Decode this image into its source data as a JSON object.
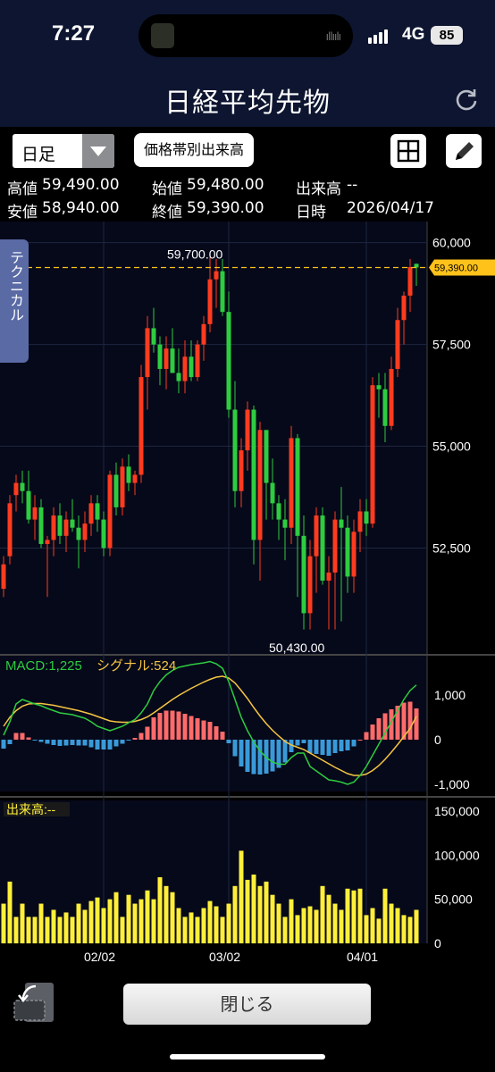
{
  "status": {
    "time": "7:27",
    "network": "4G",
    "battery": "85"
  },
  "header": {
    "title": "日経平均先物"
  },
  "toolbar": {
    "period": "日足",
    "price_band_button": "価格帯別出来高"
  },
  "info": {
    "high_label": "高値",
    "high": "59,490.00",
    "open_label": "始値",
    "open": "59,480.00",
    "volume_label": "出来高",
    "volume": "--",
    "low_label": "安値",
    "low": "58,940.00",
    "close_label": "終値",
    "close": "59,390.00",
    "datetime_label": "日時",
    "date": "2026/04/17"
  },
  "side_tab": "テクニカル",
  "close_button": "閉じる",
  "colors": {
    "up": "#ff3b1f",
    "down": "#2ecc40",
    "macd": "#2ecc40",
    "signal": "#f5c542",
    "hist_pos": "#ff6b6b",
    "hist_neg": "#3a9ad9",
    "volume": "#ffef3a",
    "price_line": "#ffc21a",
    "header_bg": "#0d1530"
  },
  "chart_data": {
    "type": "candlestick",
    "price_axis": {
      "ticks": [
        60000,
        57500,
        55000,
        52500
      ],
      "tick_labels": [
        "60,000",
        "57,500",
        "55,000",
        "52,500"
      ],
      "range": [
        49900,
        60300
      ]
    },
    "annotations": {
      "high_label": "59,700.00",
      "high_value": 59700,
      "low_label": "50,430.00",
      "low_value": 50430,
      "current_label": "59,390.00",
      "current_value": 59390
    },
    "x_labels": [
      {
        "label": "02/02",
        "index": 16
      },
      {
        "label": "03/02",
        "index": 36
      },
      {
        "label": "04/01",
        "index": 58
      }
    ],
    "candles": [
      [
        51500,
        52300,
        51300,
        52100
      ],
      [
        52300,
        53800,
        52100,
        53600
      ],
      [
        53800,
        54300,
        53400,
        54100
      ],
      [
        54100,
        54400,
        53600,
        53900
      ],
      [
        53900,
        54400,
        53100,
        53200
      ],
      [
        53200,
        53800,
        52700,
        53500
      ],
      [
        53500,
        53700,
        52500,
        52600
      ],
      [
        52600,
        52800,
        51300,
        52700
      ],
      [
        52700,
        53500,
        52300,
        53300
      ],
      [
        53300,
        53600,
        52600,
        52800
      ],
      [
        52800,
        53400,
        52400,
        53200
      ],
      [
        53200,
        53700,
        52900,
        53000
      ],
      [
        53000,
        53300,
        52000,
        52700
      ],
      [
        52700,
        53400,
        52400,
        53100
      ],
      [
        53100,
        53800,
        52800,
        53600
      ],
      [
        53600,
        53800,
        52900,
        53200
      ],
      [
        53200,
        53400,
        52300,
        52500
      ],
      [
        52500,
        54400,
        52300,
        54300
      ],
      [
        54300,
        54600,
        53300,
        53500
      ],
      [
        53500,
        54700,
        53300,
        54500
      ],
      [
        54500,
        54800,
        53900,
        54100
      ],
      [
        54100,
        54400,
        53800,
        54300
      ],
      [
        54300,
        57000,
        54100,
        56700
      ],
      [
        56700,
        58200,
        55900,
        57900
      ],
      [
        57900,
        58400,
        57300,
        57500
      ],
      [
        57500,
        57700,
        56500,
        56900
      ],
      [
        56900,
        57700,
        56400,
        57400
      ],
      [
        57400,
        57900,
        56800,
        56800
      ],
      [
        56800,
        57400,
        56300,
        56600
      ],
      [
        56600,
        57600,
        56300,
        57200
      ],
      [
        57200,
        57600,
        56600,
        56700
      ],
      [
        56700,
        57600,
        56600,
        57500
      ],
      [
        57500,
        58200,
        57100,
        58000
      ],
      [
        58000,
        59700,
        57800,
        59100
      ],
      [
        59100,
        59600,
        58400,
        59300
      ],
      [
        59300,
        59600,
        58200,
        58300
      ],
      [
        58300,
        58800,
        55700,
        55900
      ],
      [
        55900,
        56600,
        53500,
        53900
      ],
      [
        53900,
        55200,
        53500,
        54900
      ],
      [
        54900,
        56100,
        54400,
        55900
      ],
      [
        55900,
        56000,
        52100,
        52700
      ],
      [
        52700,
        55600,
        51700,
        55400
      ],
      [
        55400,
        55400,
        53200,
        54100
      ],
      [
        54100,
        54700,
        53200,
        53600
      ],
      [
        53600,
        53800,
        52700,
        53200
      ],
      [
        53200,
        53700,
        52200,
        53000
      ],
      [
        53000,
        55500,
        52600,
        55200
      ],
      [
        55200,
        55300,
        51300,
        52800
      ],
      [
        52800,
        53300,
        50500,
        50900
      ],
      [
        50900,
        52700,
        50500,
        52300
      ],
      [
        52300,
        53500,
        51400,
        53300
      ],
      [
        53300,
        53500,
        51600,
        51700
      ],
      [
        51700,
        52300,
        50500,
        51900
      ],
      [
        51900,
        53400,
        50500,
        53200
      ],
      [
        53200,
        54000,
        50700,
        53000
      ],
      [
        53000,
        53300,
        51400,
        51800
      ],
      [
        51800,
        53200,
        51400,
        52900
      ],
      [
        52900,
        53700,
        52400,
        53400
      ],
      [
        53400,
        53700,
        52800,
        53100
      ],
      [
        53100,
        56700,
        53000,
        56500
      ],
      [
        56500,
        56800,
        55700,
        56400
      ],
      [
        56400,
        56800,
        55100,
        55500
      ],
      [
        55500,
        57200,
        55400,
        56900
      ],
      [
        56900,
        58400,
        56700,
        58100
      ],
      [
        58100,
        58800,
        57500,
        58700
      ],
      [
        58700,
        59600,
        58300,
        59400
      ],
      [
        59480,
        59490,
        58940,
        59390
      ]
    ],
    "macd": {
      "label": "MACD:1,225",
      "signal_label": "シグナル:524",
      "axis_ticks": [
        1000,
        0,
        -1000
      ],
      "axis_labels": [
        "1,000",
        "0",
        "-1,000"
      ],
      "range": [
        -1200,
        1800
      ],
      "macd": [
        100,
        400,
        800,
        900,
        850,
        800,
        760,
        700,
        650,
        600,
        580,
        560,
        520,
        480,
        400,
        300,
        250,
        200,
        250,
        300,
        380,
        450,
        600,
        800,
        1100,
        1300,
        1450,
        1550,
        1620,
        1650,
        1680,
        1700,
        1720,
        1750,
        1700,
        1600,
        1300,
        900,
        500,
        200,
        -50,
        -250,
        -400,
        -500,
        -550,
        -550,
        -400,
        -300,
        -300,
        -600,
        -700,
        -800,
        -900,
        -920,
        -950,
        -1000,
        -950,
        -800,
        -600,
        -350,
        -100,
        150,
        400,
        650,
        900,
        1100,
        1225
      ],
      "signal": [
        300,
        500,
        650,
        750,
        800,
        810,
        810,
        790,
        770,
        740,
        710,
        680,
        650,
        610,
        570,
        520,
        470,
        420,
        400,
        390,
        390,
        410,
        450,
        510,
        600,
        700,
        800,
        900,
        990,
        1070,
        1150,
        1220,
        1290,
        1350,
        1400,
        1420,
        1380,
        1270,
        1100,
        920,
        720,
        530,
        360,
        210,
        80,
        -40,
        -120,
        -170,
        -220,
        -300,
        -380,
        -460,
        -540,
        -620,
        -690,
        -760,
        -800,
        -800,
        -770,
        -690,
        -580,
        -440,
        -280,
        -110,
        70,
        250,
        524
      ],
      "hist": [
        -200,
        -100,
        150,
        150,
        50,
        -10,
        -50,
        -90,
        -120,
        -140,
        -130,
        -120,
        -130,
        -130,
        -170,
        -220,
        -220,
        -220,
        -150,
        -90,
        -10,
        40,
        150,
        290,
        500,
        600,
        650,
        650,
        630,
        580,
        530,
        480,
        430,
        400,
        300,
        180,
        -80,
        -370,
        -600,
        -720,
        -770,
        -780,
        -760,
        -710,
        -630,
        -510,
        -280,
        -130,
        -80,
        -300,
        -320,
        -340,
        -360,
        -300,
        -260,
        -240,
        -150,
        0,
        170,
        340,
        480,
        590,
        680,
        760,
        830,
        850,
        700
      ]
    },
    "volume": {
      "label": "出来高:--",
      "axis_ticks": [
        150000,
        100000,
        50000,
        0
      ],
      "axis_labels": [
        "150,000",
        "100,000",
        "50,000",
        "0"
      ],
      "range": [
        0,
        160000
      ],
      "values": [
        45000,
        70000,
        30000,
        45000,
        30000,
        30000,
        45000,
        30000,
        38000,
        30000,
        35000,
        30000,
        45000,
        38000,
        48000,
        52000,
        40000,
        50000,
        58000,
        30000,
        55000,
        45000,
        50000,
        60000,
        50000,
        75000,
        65000,
        58000,
        40000,
        30000,
        35000,
        30000,
        40000,
        48000,
        42000,
        30000,
        45000,
        65000,
        105000,
        72000,
        78000,
        65000,
        70000,
        55000,
        45000,
        30000,
        50000,
        32000,
        40000,
        42000,
        38000,
        65000,
        55000,
        45000,
        38000,
        62000,
        60000,
        62000,
        32000,
        40000,
        28000,
        62000,
        45000,
        40000,
        32000,
        30000,
        38000
      ]
    }
  }
}
